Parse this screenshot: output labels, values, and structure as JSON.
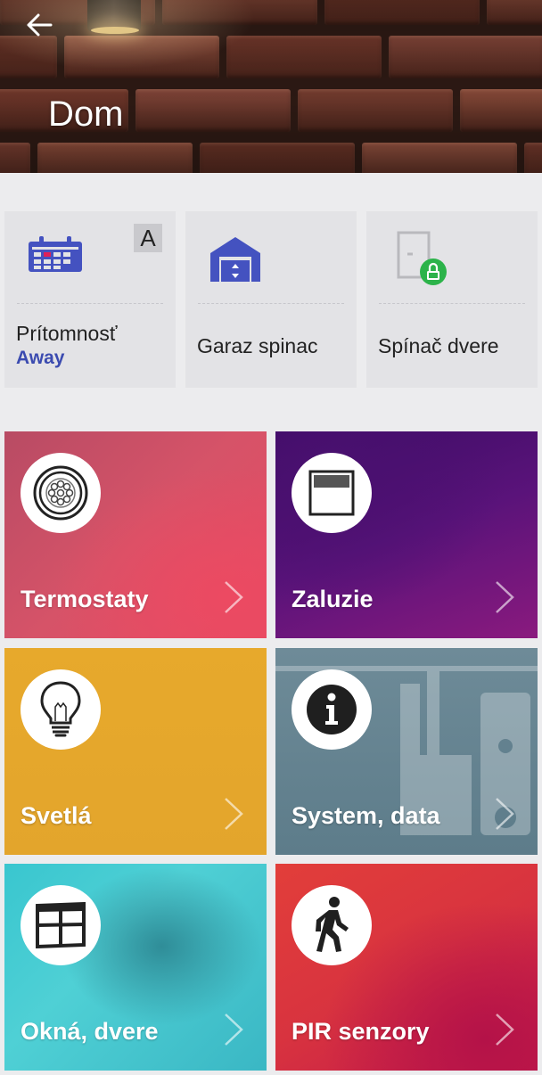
{
  "header": {
    "title": "Dom",
    "back_icon": "arrow-left-icon"
  },
  "quick_tiles": [
    {
      "label": "Prítomnosť",
      "status": "Away",
      "badge": "A",
      "icon": "calendar-icon"
    },
    {
      "label": "Garaz spinac",
      "icon": "garage-icon"
    },
    {
      "label": "Spínač dvere",
      "icon": "door-lock-icon"
    }
  ],
  "categories": [
    {
      "label": "Termostaty",
      "icon": "thermostat-icon",
      "color": "#d65368"
    },
    {
      "label": "Zaluzie",
      "icon": "blinds-icon",
      "color": "#5a137a"
    },
    {
      "label": "Svetlá",
      "icon": "lightbulb-icon",
      "color": "#e3a52c"
    },
    {
      "label": "System, data",
      "icon": "info-icon",
      "color": "#5d7c8a"
    },
    {
      "label": "Okná, dvere",
      "icon": "window-icon",
      "color": "#3ab7c4"
    },
    {
      "label": "PIR senzory",
      "icon": "walking-person-icon",
      "color": "#d8333f"
    }
  ],
  "colors": {
    "accent": "#3b4bb0",
    "icon_blue": "#4452c0",
    "background": "#ececee"
  }
}
